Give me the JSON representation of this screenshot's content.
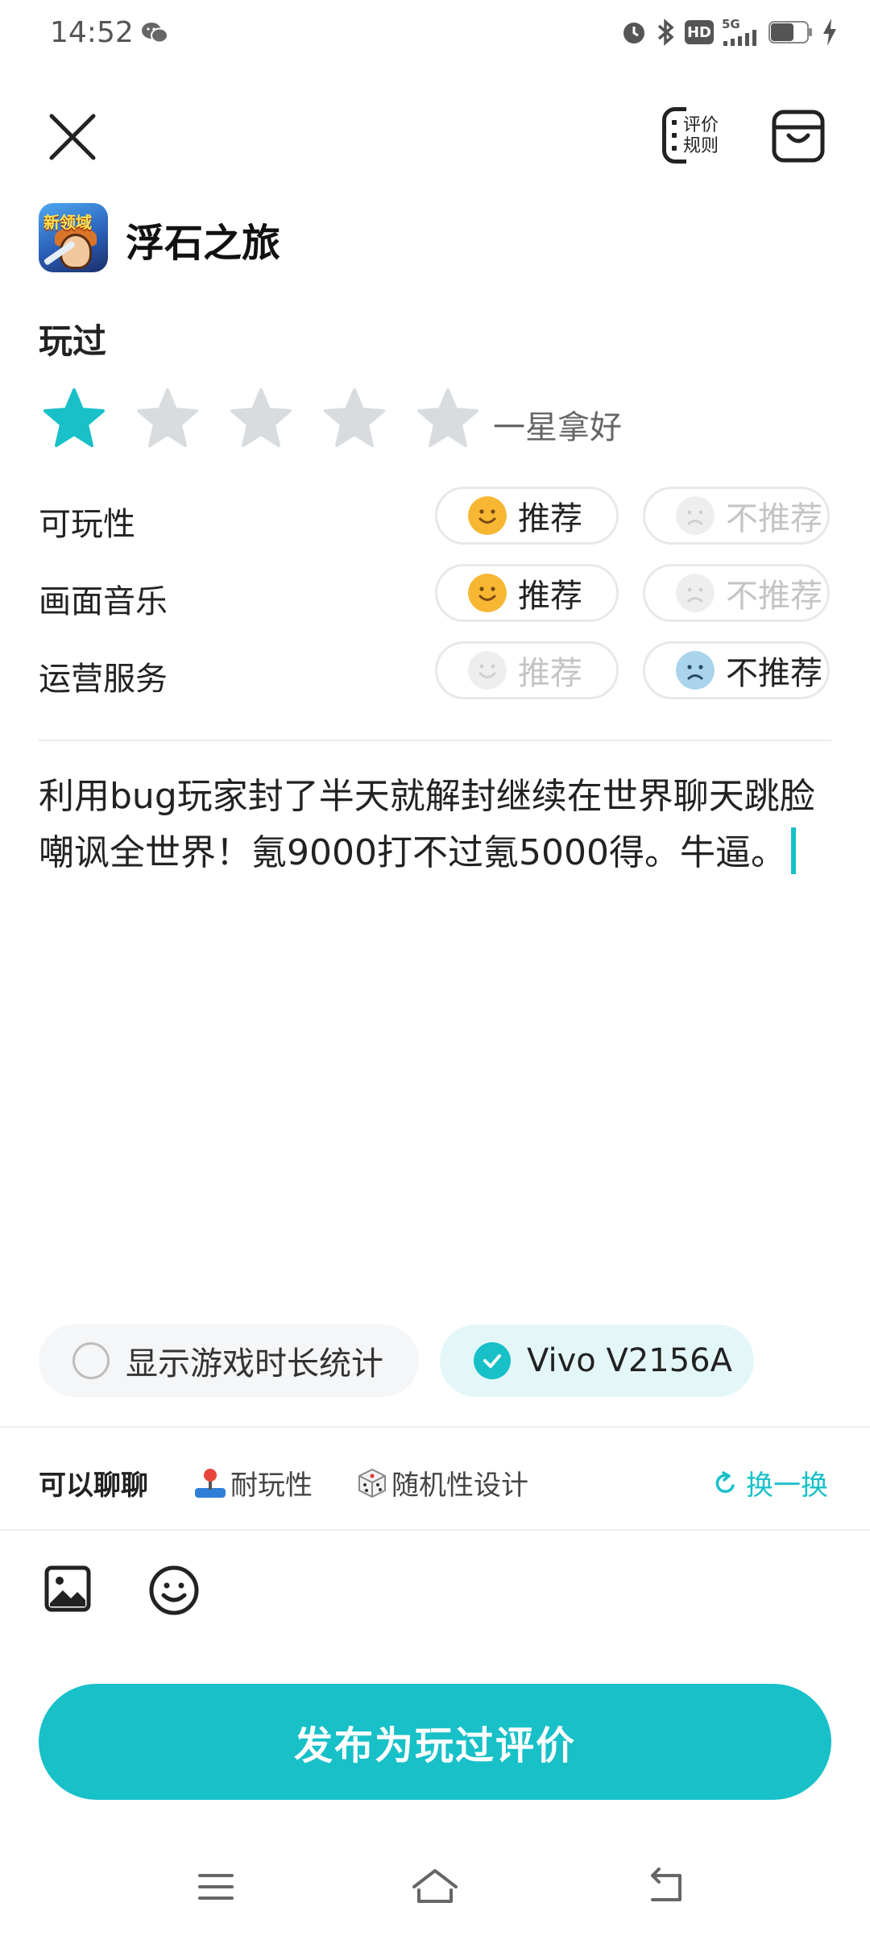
{
  "status_bar": {
    "time": "14:52",
    "wechat_icon": "wechat-icon",
    "icons": [
      "alarm-icon",
      "bluetooth-icon",
      "hd-icon",
      "5g-signal-icon",
      "battery-icon",
      "charging-icon"
    ],
    "hd_label": "HD",
    "network_label": "5G"
  },
  "toolbar": {
    "close_icon": "close-icon",
    "rules_label_line1": "评价",
    "rules_label_line2": "规则",
    "store_icon": "bag-icon"
  },
  "game": {
    "icon_title": "新领域",
    "name": "浮石之旅"
  },
  "review": {
    "status_label": "玩过",
    "rating": 1,
    "rating_max": 5,
    "rating_text": "一星拿好",
    "criteria": [
      {
        "label": "可玩性",
        "recommend": "推荐",
        "not_recommend": "不推荐",
        "selected": "recommend"
      },
      {
        "label": "画面音乐",
        "recommend": "推荐",
        "not_recommend": "不推荐",
        "selected": "recommend"
      },
      {
        "label": "运营服务",
        "recommend": "推荐",
        "not_recommend": "不推荐",
        "selected": "not_recommend"
      }
    ],
    "text": "利用bug玩家封了半天就解封继续在世界聊天跳脸嘲讽全世界！氪9000打不过氪5000得。牛逼。"
  },
  "options": {
    "show_playtime": "显示游戏时长统计",
    "device": "Vivo V2156A"
  },
  "topics": {
    "label": "可以聊聊",
    "items": [
      {
        "label": "耐玩性",
        "icon": "joystick-icon"
      },
      {
        "label": "随机性设计",
        "icon": "dice-icon"
      }
    ],
    "refresh": "换一换"
  },
  "actions": {
    "image_icon": "image-icon",
    "emoji_icon": "emoji-icon",
    "publish_label": "发布为玩过评价"
  },
  "nav_bar": [
    "menu-icon",
    "home-icon",
    "back-icon"
  ],
  "colors": {
    "accent": "#18c0c8",
    "star_inactive": "#d9dcdf",
    "smile_face": "#f7b733",
    "sad_face": "#a9d4ec"
  }
}
